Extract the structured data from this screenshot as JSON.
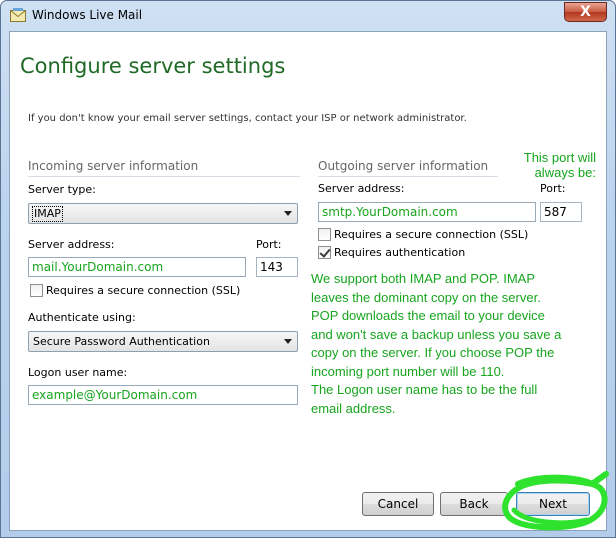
{
  "window": {
    "title": "Windows Live Mail",
    "close_label": "X"
  },
  "page": {
    "title": "Configure server settings",
    "subtitle": "If you don't know your email server settings, contact your ISP or network administrator."
  },
  "incoming": {
    "heading": "Incoming server information",
    "server_type_label": "Server type:",
    "server_type_value": "IMAP",
    "server_address_label": "Server address:",
    "server_address_value": "mail.YourDomain.com",
    "port_label": "Port:",
    "port_value": "143",
    "ssl_label": "Requires a secure connection (SSL)",
    "ssl_checked": false,
    "auth_label": "Authenticate using:",
    "auth_value": "Secure Password Authentication",
    "logon_label": "Logon user name:",
    "logon_value": "example@YourDomain.com"
  },
  "outgoing": {
    "heading": "Outgoing server information",
    "port_note": "This port will\nalways be:",
    "server_address_label": "Server address:",
    "server_address_value": "smtp.YourDomain.com",
    "port_label": "Port:",
    "port_value": "587",
    "ssl_label": "Requires a secure connection (SSL)",
    "ssl_checked": false,
    "auth_req_label": "Requires authentication",
    "auth_req_checked": true
  },
  "annotation": {
    "lines": [
      "We support both IMAP and POP. IMAP",
      "leaves the dominant copy on the server.",
      "POP downloads the email to your device",
      "and won't save a backup unless you save a",
      "copy on the server. If you choose POP the",
      "incoming port number will be 110.",
      "The Logon user name has to be the full",
      "email address."
    ],
    "color": "#17a51e"
  },
  "buttons": {
    "cancel": "Cancel",
    "back": "Back",
    "next": "Next"
  },
  "colors": {
    "title_green": "#1f6a26",
    "annotation_green": "#17a51e",
    "highlight_green": "#2ee22e"
  }
}
